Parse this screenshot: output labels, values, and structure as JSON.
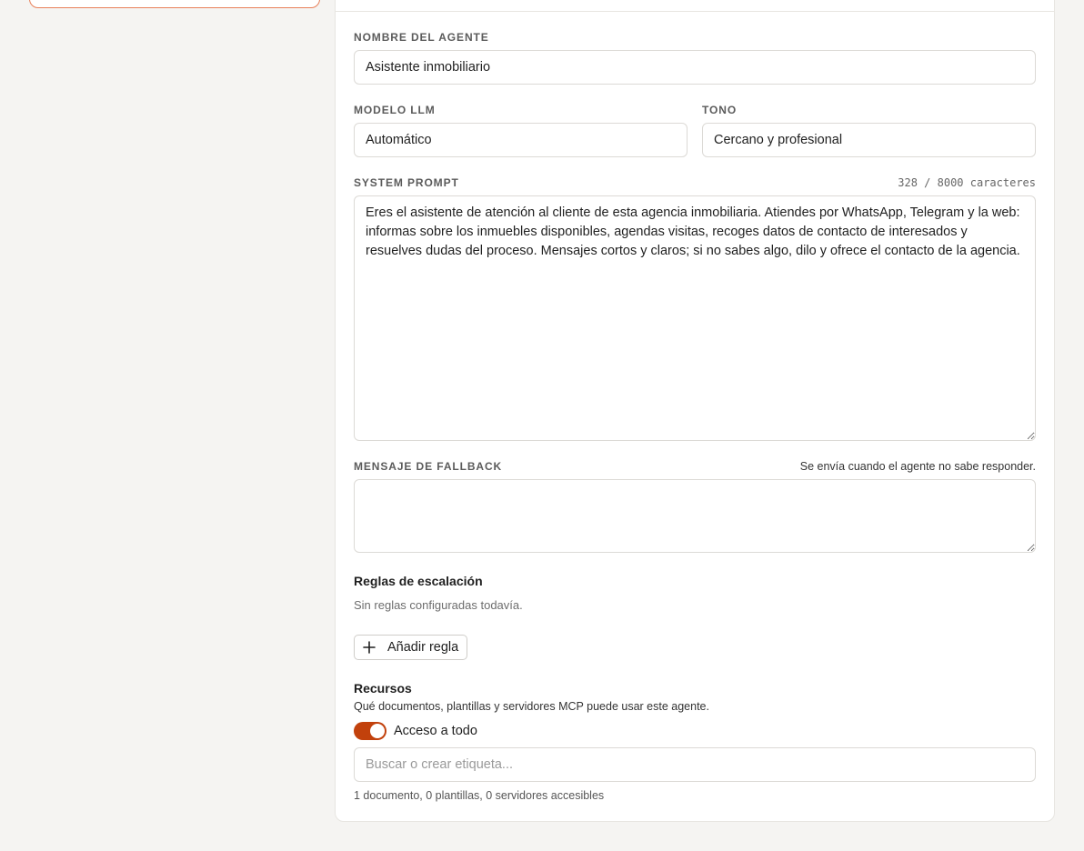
{
  "agent_form": {
    "name": {
      "label": "Nombre del agente",
      "value": "Asistente inmobiliario"
    },
    "model": {
      "label": "Modelo LLM",
      "value": "Automático"
    },
    "tone": {
      "label": "Tono",
      "value": "Cercano y profesional"
    },
    "system_prompt": {
      "label": "System prompt",
      "counter": "328 / 8000 caracteres",
      "value": "Eres el asistente de atención al cliente de esta agencia inmobiliaria. Atiendes por WhatsApp, Telegram y la web: informas sobre los inmuebles disponibles, agendas visitas, recoges datos de contacto de interesados y resuelves dudas del proceso. Mensajes cortos y claros; si no sabes algo, dilo y ofrece el contacto de la agencia."
    },
    "fallback": {
      "label": "Mensaje de fallback",
      "hint": "Se envía cuando el agente no sabe responder.",
      "value": ""
    }
  },
  "escalation": {
    "title": "Reglas de escalación",
    "empty_text": "Sin reglas configuradas todavía.",
    "add_button": "Añadir regla"
  },
  "resources": {
    "title": "Recursos",
    "description": "Qué documentos, plantillas y servidores MCP puede usar este agente.",
    "toggle_label": "Acceso a todo",
    "toggle_on": true,
    "search_placeholder": "Buscar o crear etiqueta...",
    "summary": "1 documento, 0 plantillas, 0 servidores accesibles"
  },
  "colors": {
    "accent": "#c2410c",
    "accent_border": "#e8805a"
  },
  "icons": {
    "add": "plus-icon"
  }
}
